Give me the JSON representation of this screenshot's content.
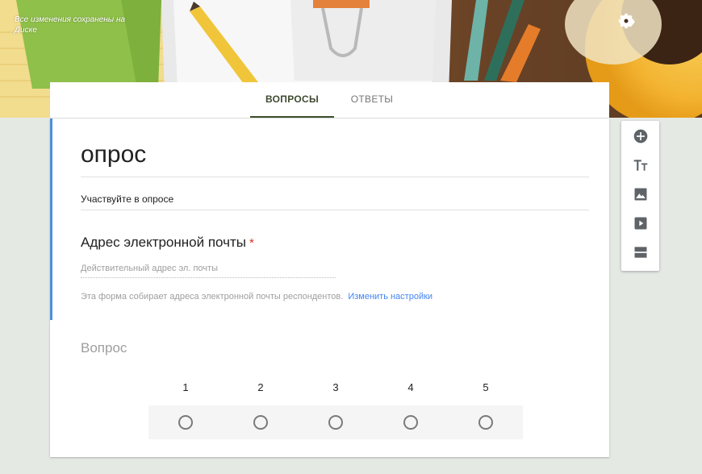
{
  "header": {
    "save_status": "Все изменения сохранены на Диске",
    "icons": [
      "palette-icon",
      "eye-icon",
      "gear-icon"
    ]
  },
  "tabs": {
    "questions": "ВОПРОСЫ",
    "responses": "ОТВЕТЫ"
  },
  "form": {
    "title": "опрос",
    "description": "Участвуйте в опросе",
    "email_question": {
      "title": "Адрес электронной почты",
      "required_mark": "*",
      "placeholder": "Действительный адрес эл. почты",
      "note": "Эта форма собирает адреса электронной почты респондентов.",
      "link": "Изменить настройки"
    },
    "question2": {
      "title": "Вопрос",
      "scale": [
        "1",
        "2",
        "3",
        "4",
        "5"
      ]
    }
  },
  "toolbar": {
    "items": [
      "add-question-icon",
      "title-text-icon",
      "image-icon",
      "video-icon",
      "section-icon"
    ]
  },
  "colors": {
    "accent": "#4d90d6",
    "link": "#4285f4",
    "required": "#d93025",
    "tab_indicator": "#3f4e2c",
    "background": "#e5e9e4"
  }
}
